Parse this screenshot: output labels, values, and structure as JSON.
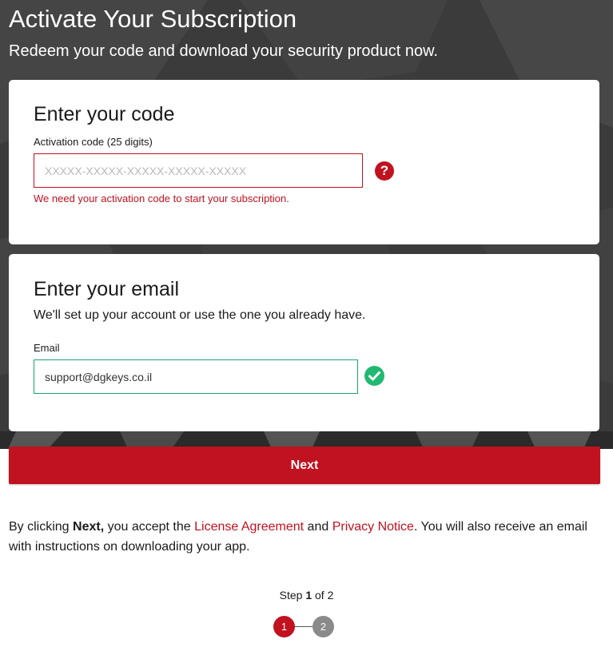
{
  "hero": {
    "title": "Activate Your Subscription",
    "subtitle": "Redeem your code and download your security product now."
  },
  "code_card": {
    "heading": "Enter your code",
    "label": "Activation code (25 digits)",
    "placeholder": "XXXXX-XXXXX-XXXXX-XXXXX-XXXXX",
    "value": "",
    "error": "We need your activation code to start your subscription.",
    "help_icon": "question-icon",
    "help_glyph": "?"
  },
  "email_card": {
    "heading": "Enter your email",
    "description": "We'll set up your account or use the one you already have.",
    "label": "Email",
    "value": "support@dgkeys.co.il",
    "valid_icon": "check-circle-icon"
  },
  "next_button": {
    "label": "Next"
  },
  "legal": {
    "prefix": "By clicking ",
    "next_word": "Next,",
    "middle": " you accept the ",
    "license_link": "License Agreement",
    "and": " and ",
    "privacy_link": "Privacy Notice",
    "suffix": ". You will also receive an email with instructions on downloading your app."
  },
  "stepper": {
    "prefix": "Step ",
    "current": "1",
    "middle": " of ",
    "total": "2",
    "step1": "1",
    "step2": "2"
  },
  "colors": {
    "accent": "#c1121f",
    "success": "#22b872",
    "hero_bg": "#3a3a3a",
    "inactive_step": "#8a8a8a"
  }
}
